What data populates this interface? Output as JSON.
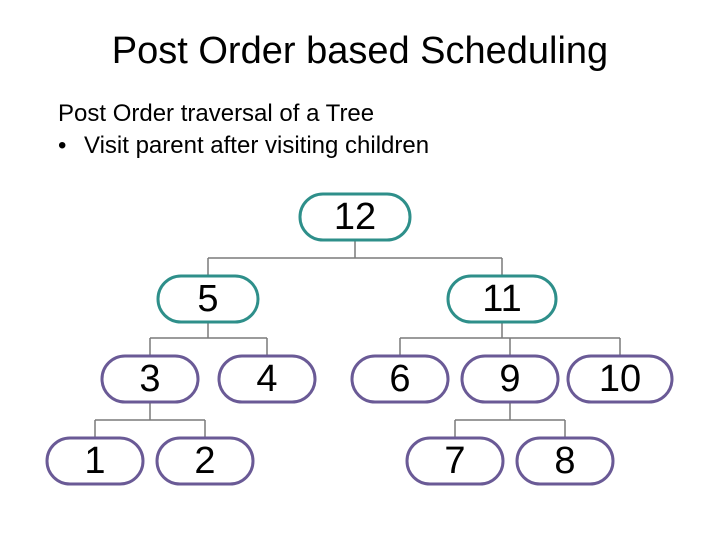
{
  "title": "Post Order based Scheduling",
  "subtitle_line1": "Post Order traversal of a Tree",
  "bullet1": "Visit parent after visiting children",
  "nodes": {
    "n12": "12",
    "n5": "5",
    "n11": "11",
    "n3": "3",
    "n4": "4",
    "n6": "6",
    "n9": "9",
    "n10": "10",
    "n1": "1",
    "n2": "2",
    "n7": "7",
    "n8": "8"
  },
  "colors": {
    "teal": "#2e8f8a",
    "purple": "#6a5a96"
  }
}
